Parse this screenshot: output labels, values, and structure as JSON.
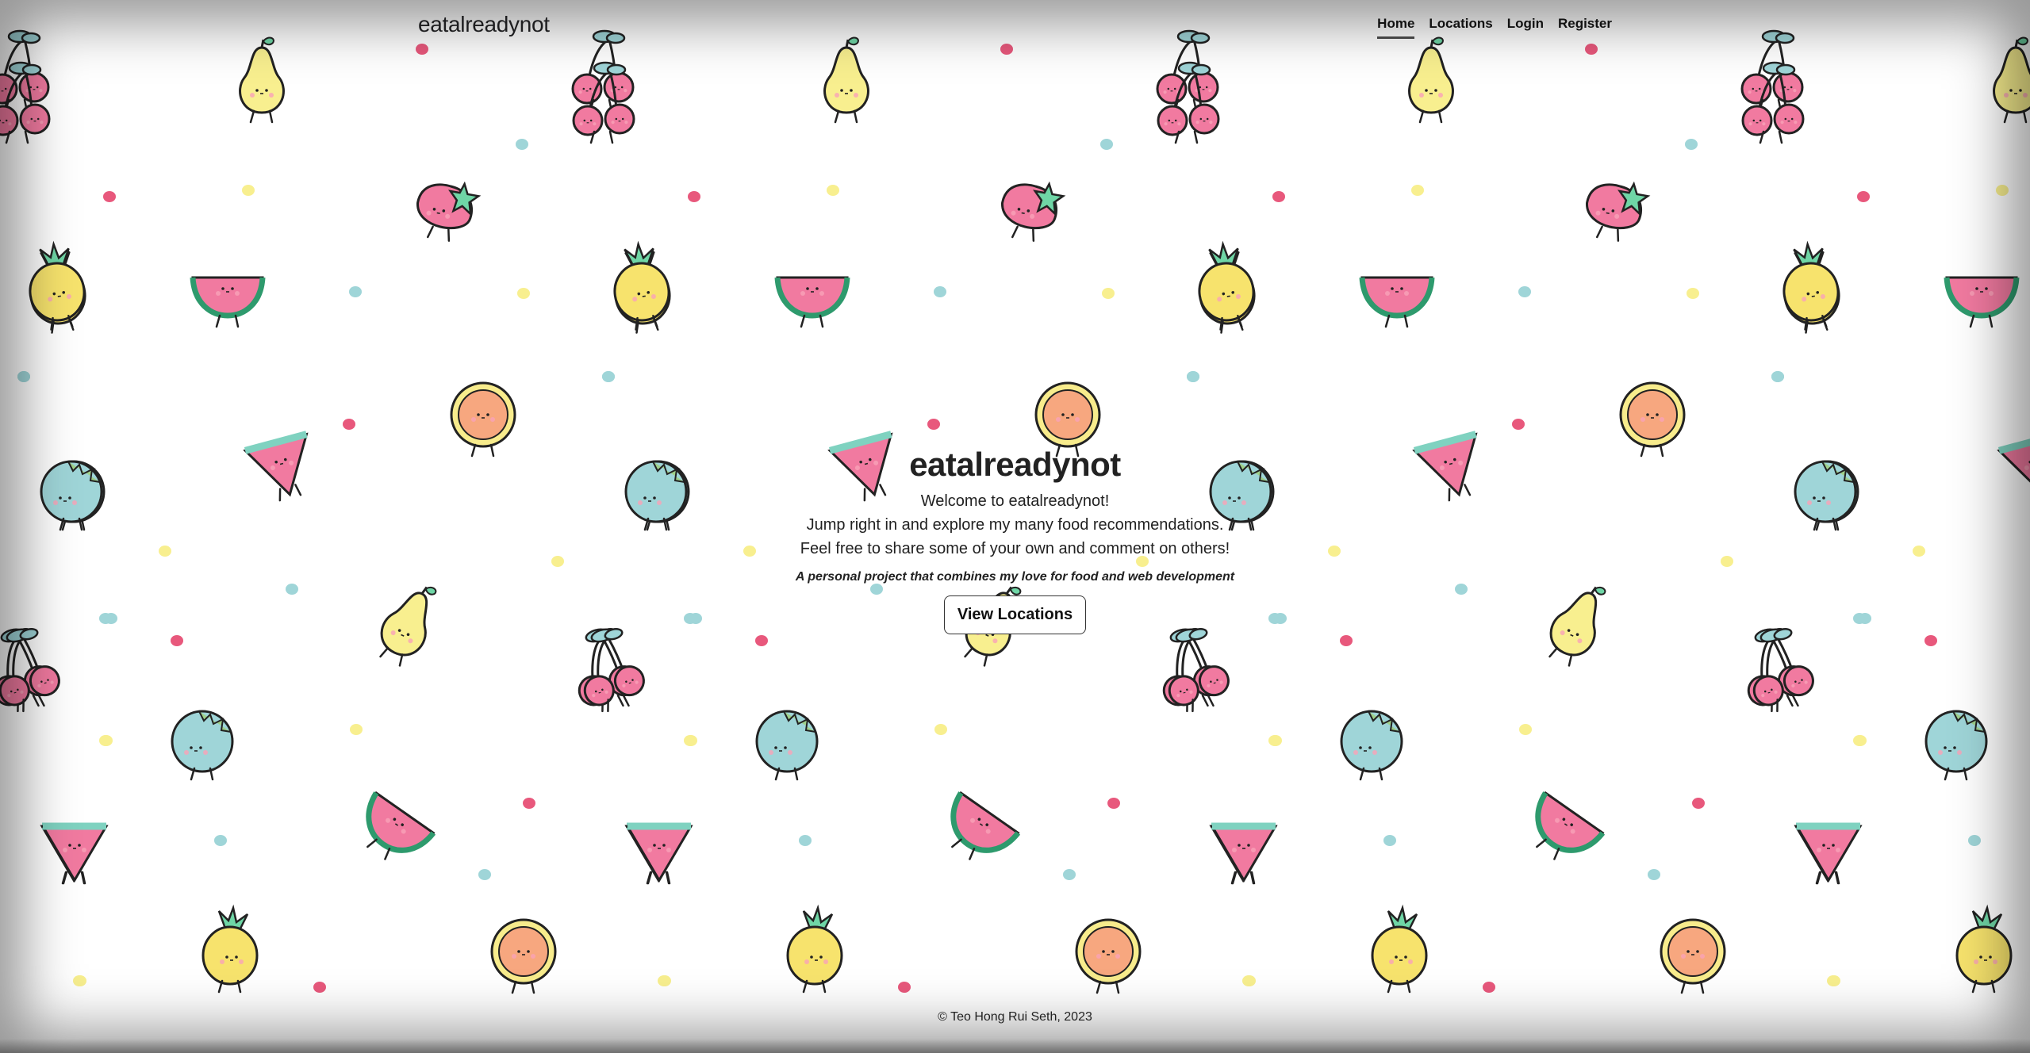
{
  "navbar": {
    "brand": "eatalreadynot",
    "links": [
      {
        "label": "Home",
        "active": true
      },
      {
        "label": "Locations",
        "active": false
      },
      {
        "label": "Login",
        "active": false
      },
      {
        "label": "Register",
        "active": false
      }
    ]
  },
  "hero": {
    "title": "eatalreadynot",
    "lines": [
      "Welcome to eatalreadynot!",
      "Jump right in and explore my many food recommendations.",
      "Feel free to share some of your own and comment on others!"
    ],
    "tagline": "A personal project that combines my love for food and web development",
    "button_label": "View Locations"
  },
  "footer": {
    "text": "© Teo Hong Rui Seth, 2023"
  },
  "background": {
    "pattern": "kawaii-fruit-doodles",
    "icons": [
      "pear-icon",
      "cherries-icon",
      "strawberry-icon",
      "watermelon-slice-icon",
      "pineapple-icon",
      "orange-icon",
      "blueberry-icon",
      "watermelon-wedge-icon"
    ],
    "colors": {
      "pink": "#f17aa0",
      "yellow": "#f8ef8f",
      "teal": "#9fd5d8",
      "red-dot": "#e8587c",
      "orange": "#f7a77f",
      "green": "#6fd6a6",
      "outline": "#222222"
    }
  }
}
